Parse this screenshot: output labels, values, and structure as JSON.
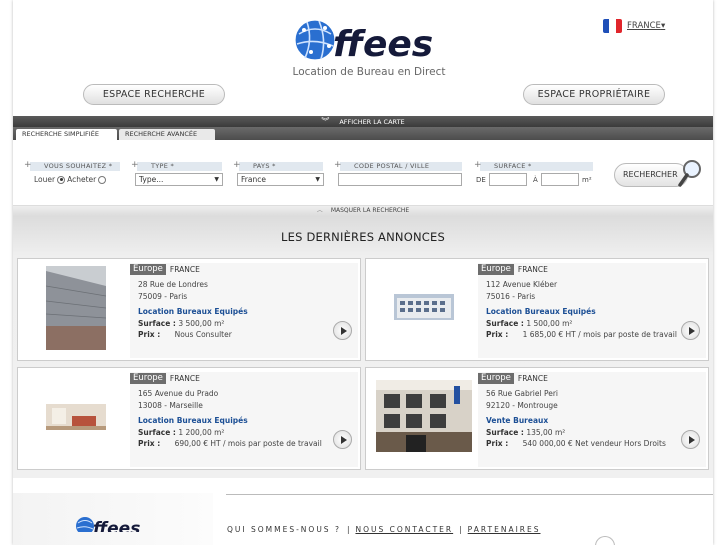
{
  "header": {
    "logo_text": "ffees",
    "tagline": "Location de Bureau en Direct",
    "language": "FRANCE",
    "btn_search": "ESPACE RECHERCHE",
    "btn_owner": "ESPACE PROPRIÉTAIRE"
  },
  "mapbar": {
    "label": "AFFICHER LA CARTE"
  },
  "tabs": [
    {
      "label": "RECHERCHE SIMPLIFIÉE",
      "active": true
    },
    {
      "label": "RECHERCHE AVANCÉE",
      "active": false
    }
  ],
  "search": {
    "souhaitez_label": "VOUS SOUHAITEZ *",
    "louer": "Louer",
    "acheter": "Acheter",
    "type_label": "TYPE *",
    "type_value": "Type...",
    "pays_label": "PAYS *",
    "pays_value": "France",
    "cp_label": "CODE POSTAL / VILLE",
    "cp_value": "",
    "surface_label": "SURFACE *",
    "de": "DE",
    "a": "À",
    "unit": "m²",
    "button": "RECHERCHER"
  },
  "maskbar": {
    "label": "MASQUER LA RECHERCHE"
  },
  "section_title": "LES DERNIÈRES ANNONCES",
  "listings": [
    {
      "badge": "Europe",
      "country": "FRANCE",
      "street": "28 Rue de Londres",
      "city": "75009 - Paris",
      "type": "Location Bureaux Equipés",
      "surface_label": "Surface :",
      "surface": "3 500,00 m²",
      "price_label": "Prix :",
      "price": "Nous Consulter"
    },
    {
      "badge": "Europe",
      "country": "FRANCE",
      "street": "112 Avenue Kléber",
      "city": "75016 - Paris",
      "type": "Location Bureaux Equipés",
      "surface_label": "Surface :",
      "surface": "1 500,00 m²",
      "price_label": "Prix :",
      "price": "1 685,00 € HT / mois par poste de travail"
    },
    {
      "badge": "Europe",
      "country": "FRANCE",
      "street": "165 Avenue du Prado",
      "city": "13008 - Marseille",
      "type": "Location Bureaux Equipés",
      "surface_label": "Surface :",
      "surface": "1 200,00 m²",
      "price_label": "Prix :",
      "price": "690,00 € HT / mois par poste de travail"
    },
    {
      "badge": "Europe",
      "country": "FRANCE",
      "street": "56 Rue Gabriel Peri",
      "city": "92120 - Montrouge",
      "type": "Vente Bureaux",
      "surface_label": "Surface :",
      "surface": "135,00 m²",
      "price_label": "Prix :",
      "price": "540 000,00 € Net vendeur Hors Droits"
    }
  ],
  "footer": {
    "links": [
      "QUI SOMMES-NOUS ?",
      "NOUS CONTACTER",
      "PARTENAIRES"
    ]
  },
  "colors": {
    "accent": "#1c4f95",
    "bar": "#4a4a4a",
    "label_bg": "#e1e8ef"
  }
}
